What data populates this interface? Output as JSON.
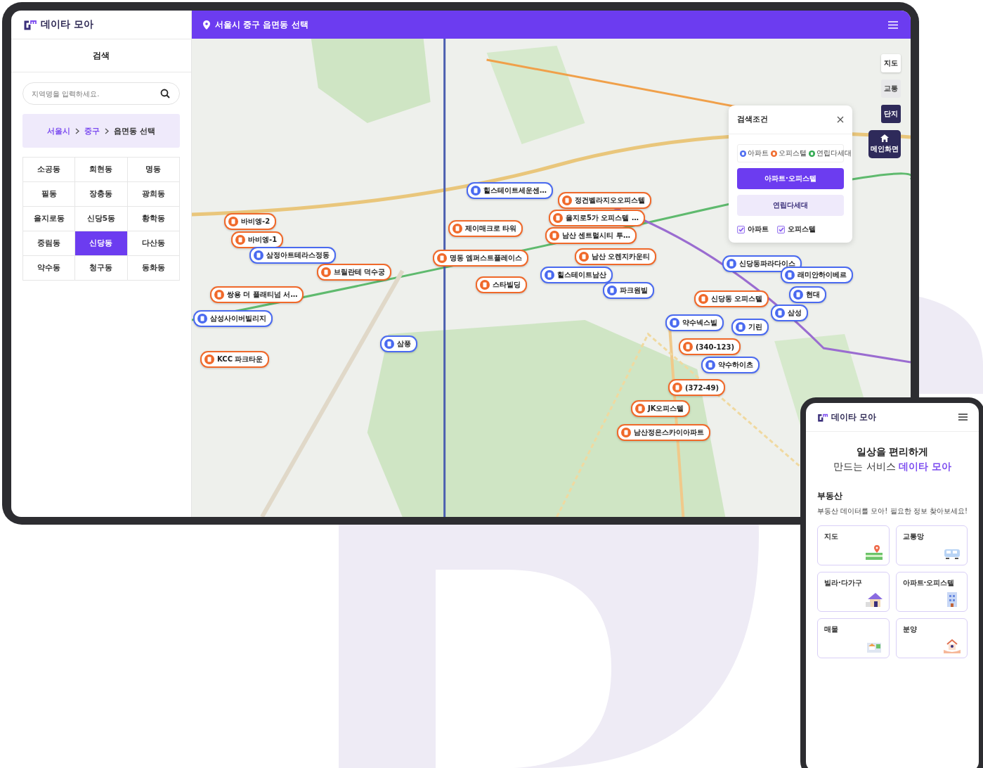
{
  "tablet": {
    "sidebar": {
      "logo": "데이타 모아",
      "title": "검색",
      "search": {
        "placeholder": "지역명을 입력하세요."
      },
      "breadcrumb": [
        {
          "label": "서울시",
          "current": false
        },
        {
          "label": "중구",
          "current": false
        },
        {
          "label": "읍면동 선택",
          "current": true
        }
      ],
      "districts": [
        {
          "label": "소공동",
          "selected": false
        },
        {
          "label": "회현동",
          "selected": false
        },
        {
          "label": "명동",
          "selected": false
        },
        {
          "label": "필동",
          "selected": false
        },
        {
          "label": "장충동",
          "selected": false
        },
        {
          "label": "광희동",
          "selected": false
        },
        {
          "label": "을지로동",
          "selected": false
        },
        {
          "label": "신당5동",
          "selected": false
        },
        {
          "label": "황학동",
          "selected": false
        },
        {
          "label": "중림동",
          "selected": false
        },
        {
          "label": "신당동",
          "selected": true
        },
        {
          "label": "다산동",
          "selected": false
        },
        {
          "label": "약수동",
          "selected": false
        },
        {
          "label": "청구동",
          "selected": false
        },
        {
          "label": "동화동",
          "selected": false
        }
      ]
    },
    "topbar": {
      "location": "서울시 중구 읍면동 선택"
    },
    "map": {
      "layers": [
        {
          "label": "지도",
          "kind": "light"
        },
        {
          "label": "교통",
          "kind": "grey"
        },
        {
          "label": "단지",
          "kind": "dark"
        },
        {
          "label": "메인화면",
          "kind": "home"
        }
      ],
      "markers": [
        {
          "label": "바비엥-2",
          "kind": "officetel"
        },
        {
          "label": "바비엥-1",
          "kind": "officetel"
        },
        {
          "label": "삼정아트테라스정동",
          "kind": "apartment"
        },
        {
          "label": "브릴란테 덕수궁",
          "kind": "officetel"
        },
        {
          "label": "쌍용 더 플래티넘 서…",
          "kind": "officetel"
        },
        {
          "label": "삼성사이버빌리지",
          "kind": "apartment"
        },
        {
          "label": "KCC 파크타운",
          "kind": "officetel"
        },
        {
          "label": "삼풍",
          "kind": "apartment"
        },
        {
          "label": "힐스테이트세운센…",
          "kind": "apartment"
        },
        {
          "label": "정건벨라지오오피스텔",
          "kind": "officetel"
        },
        {
          "label": "을지로5가 오피스텔 …",
          "kind": "officetel"
        },
        {
          "label": "제이매크로 타워",
          "kind": "officetel"
        },
        {
          "label": "남산 센트럴시티 투…",
          "kind": "officetel"
        },
        {
          "label": "명동 엠퍼스트플레이스",
          "kind": "officetel"
        },
        {
          "label": "남산 오렌지카운티",
          "kind": "officetel"
        },
        {
          "label": "힐스테이트남산",
          "kind": "apartment"
        },
        {
          "label": "스타빌딩",
          "kind": "officetel"
        },
        {
          "label": "파크원빌",
          "kind": "apartment"
        },
        {
          "label": "신당동파라다이스",
          "kind": "apartment"
        },
        {
          "label": "래미안하이베르",
          "kind": "apartment"
        },
        {
          "label": "신당동 오피스텔",
          "kind": "officetel"
        },
        {
          "label": "현대",
          "kind": "apartment"
        },
        {
          "label": "약수넥스빌",
          "kind": "apartment"
        },
        {
          "label": "기린",
          "kind": "apartment"
        },
        {
          "label": "삼성",
          "kind": "apartment"
        },
        {
          "label": "(340-123)",
          "kind": "officetel"
        },
        {
          "label": "약수하이츠",
          "kind": "apartment"
        },
        {
          "label": "(372-49)",
          "kind": "officetel"
        },
        {
          "label": "JK오피스텔",
          "kind": "officetel"
        },
        {
          "label": "남산정은스카이아파트",
          "kind": "officetel"
        }
      ],
      "filter_panel": {
        "title": "검색조건",
        "legend": [
          {
            "label": "아파트",
            "color": "#4a6af0"
          },
          {
            "label": "오피스텔",
            "color": "#f0692a"
          },
          {
            "label": "연립다세대",
            "color": "#2ea84e"
          }
        ],
        "types": [
          {
            "label": "아파트·오피스텔",
            "selected": true
          },
          {
            "label": "연립다세대",
            "selected": false
          }
        ],
        "checks": [
          {
            "label": "아파트",
            "checked": true
          },
          {
            "label": "오피스텔",
            "checked": true
          }
        ]
      }
    }
  },
  "phone": {
    "logo": "데이타 모아",
    "headline": "일상을 편리하게",
    "headline_2": "만드는 서비스 **데이타 모아**",
    "section": {
      "title": "부동산",
      "subtitle": "부동산 데이터를 모아! 필요한 정보 찾아보세요!",
      "cards": [
        {
          "label": "지도",
          "kind": "map"
        },
        {
          "label": "교통망",
          "kind": "transit"
        },
        {
          "label": "빌라·다가구",
          "kind": "house"
        },
        {
          "label": "아파트·오피스텔",
          "kind": "building"
        },
        {
          "label": "매물",
          "kind": "listing"
        },
        {
          "label": "분양",
          "kind": "sale"
        }
      ]
    }
  }
}
